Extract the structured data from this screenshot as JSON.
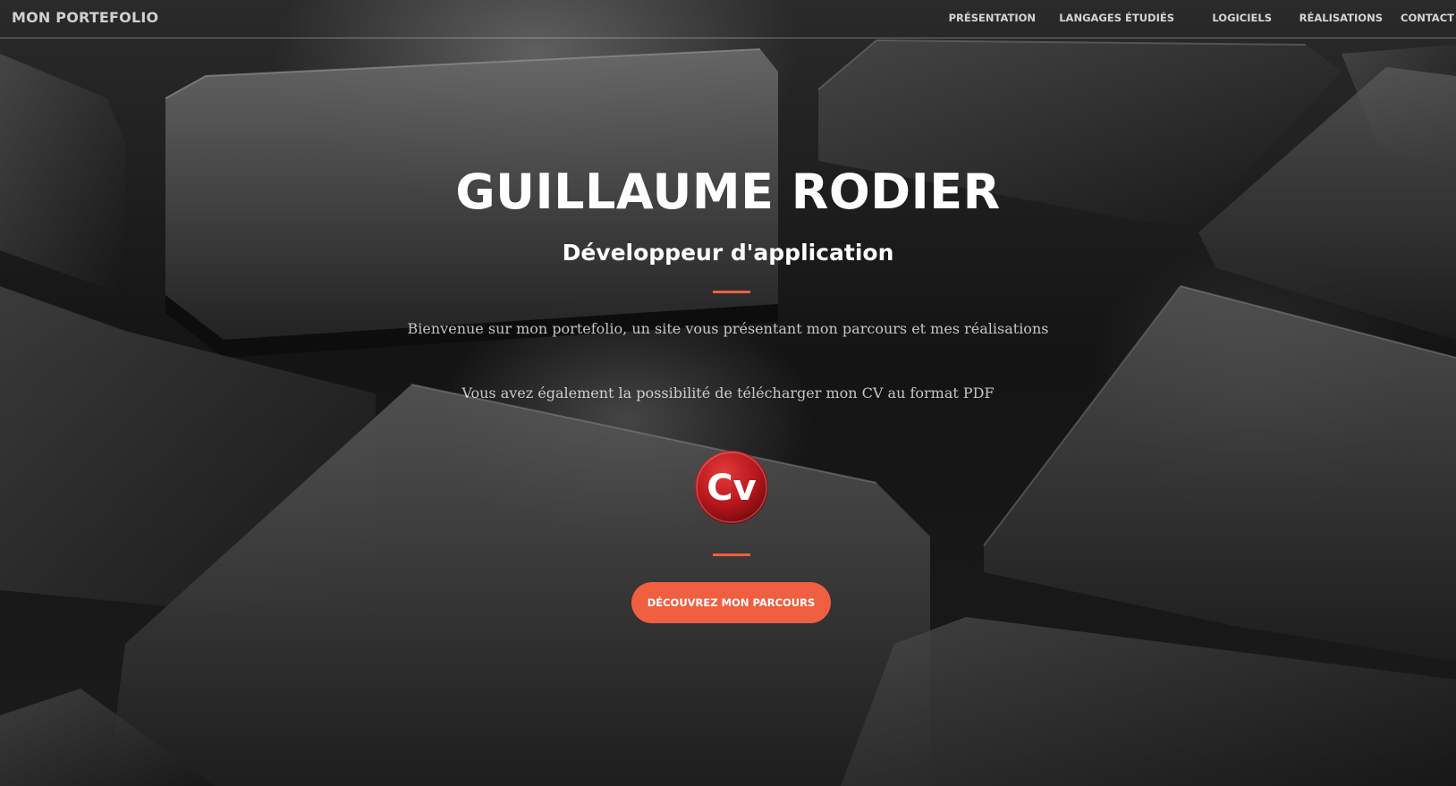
{
  "navbar": {
    "brand": "MON PORTEFOLIO",
    "items": [
      {
        "label": "PRÉSENTATION"
      },
      {
        "label": "LANGAGES ÉTUDIÉS"
      },
      {
        "label": "LOGICIELS"
      },
      {
        "label": "RÉALISATIONS"
      },
      {
        "label": "CONTACT"
      }
    ]
  },
  "hero": {
    "name": "GUILLAUME RODIER",
    "role": "Développeur d'application",
    "welcome": "Bienvenue sur mon portefolio, un site vous présentant mon parcours et mes réalisations",
    "cv_text": "Vous avez également la possibilité de télécharger mon CV au format PDF",
    "cv_icon": {
      "icon": "cv-icon",
      "text": "Cv",
      "color": "#b5161c"
    },
    "cta_label": "DÉCOUVREZ MON PARCOURS"
  },
  "colors": {
    "accent": "#f05f40",
    "background": "#1a1a1a",
    "text": "#ffffff"
  }
}
